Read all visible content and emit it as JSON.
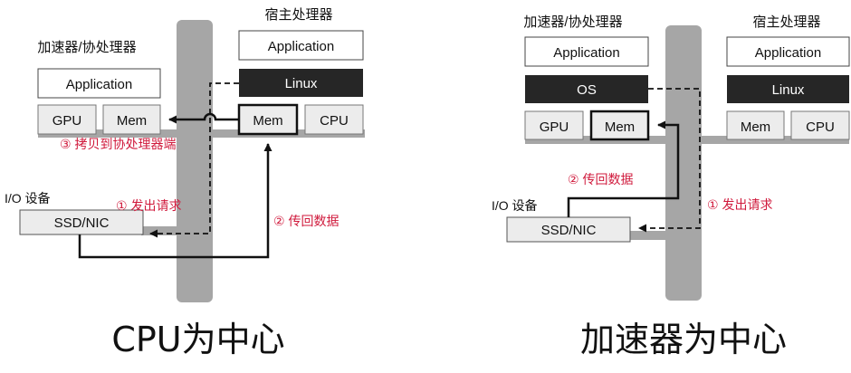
{
  "colors": {
    "bus": "#a6a6a6",
    "box_fill": "#ececec",
    "dark_box": "#262626",
    "arrow": "#111111",
    "annotation": "#d01a3c"
  },
  "left": {
    "title": "CPU为中心",
    "host_label": "宿主处理器",
    "accel_label": "加速器/协处理器",
    "host_app": "Application",
    "host_os": "Linux",
    "host_mem": "Mem",
    "host_cpu": "CPU",
    "accel_app": "Application",
    "accel_gpu": "GPU",
    "accel_mem": "Mem",
    "io_label": "I/O 设备",
    "io_device": "SSD/NIC",
    "step1": "① 发出请求",
    "step2": "② 传回数据",
    "step3": "③ 拷贝到协处理器端"
  },
  "right": {
    "title": "加速器为中心",
    "host_label": "宿主处理器",
    "accel_label": "加速器/协处理器",
    "host_app": "Application",
    "host_os": "Linux",
    "host_mem": "Mem",
    "host_cpu": "CPU",
    "accel_app": "Application",
    "accel_os": "OS",
    "accel_gpu": "GPU",
    "accel_mem": "Mem",
    "io_label": "I/O 设备",
    "io_device": "SSD/NIC",
    "step1": "① 发出请求",
    "step2": "② 传回数据"
  }
}
